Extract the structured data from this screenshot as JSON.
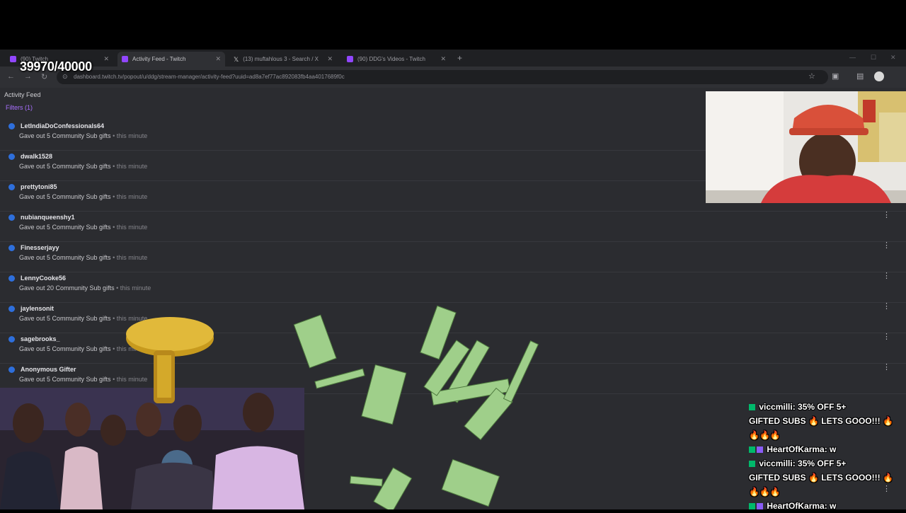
{
  "overlay": {
    "sub_goal": "39970/40000"
  },
  "browser": {
    "tabs": [
      {
        "label": "(90) Twitch",
        "active": false,
        "favicon": "twitch-icon"
      },
      {
        "label": "Activity Feed - Twitch",
        "active": true,
        "favicon": "twitch-icon"
      },
      {
        "label": "(13) muftahlous 3 - Search / X",
        "active": false,
        "favicon": "x-icon"
      },
      {
        "label": "(90) DDG's Videos - Twitch",
        "active": false,
        "favicon": "twitch-icon"
      }
    ],
    "address": "dashboard.twitch.tv/popout/u/ddg/stream-manager/activity-feed?uuid=ad8a7ef77ac892083fb4aa4017689f0c"
  },
  "activity_feed": {
    "title": "Activity Feed",
    "filters_label": "Filters (1)",
    "items": [
      {
        "user": "LetIndiaDoConfessionals64",
        "action": "Gave out 5 Community Sub gifts",
        "time": "• this minute"
      },
      {
        "user": "dwalk1528",
        "action": "Gave out 5 Community Sub gifts",
        "time": "• this minute"
      },
      {
        "user": "prettytoni85",
        "action": "Gave out 5 Community Sub gifts",
        "time": "• this minute"
      },
      {
        "user": "nubianqueenshy1",
        "action": "Gave out 5 Community Sub gifts",
        "time": "• this minute"
      },
      {
        "user": "Finesserjayy",
        "action": "Gave out 5 Community Sub gifts",
        "time": "• this minute"
      },
      {
        "user": "LennyCooke56",
        "action": "Gave out 20 Community Sub gifts",
        "time": "• this minute"
      },
      {
        "user": "jaylensonit",
        "action": "Gave out 5 Community Sub gifts",
        "time": "• this minute"
      },
      {
        "user": "sagebrooks_",
        "action": "Gave out 5 Community Sub gifts",
        "time": "• this minute"
      },
      {
        "user": "Anonymous Gifter",
        "action": "Gave out 5 Community Sub gifts",
        "time": "• this minute"
      }
    ]
  },
  "chat": {
    "messages": [
      {
        "user": "viccmilli:",
        "text": "35% OFF 5+",
        "cont": "GIFTED SUBS 🔥 LETS GOOO!!! 🔥",
        "cont2": "🔥🔥🔥"
      },
      {
        "user": "HeartOfKarma:",
        "text": "w"
      },
      {
        "user": "viccmilli:",
        "text": "35% OFF 5+",
        "cont": "GIFTED SUBS 🔥 LETS GOOO!!! 🔥",
        "cont2": "🔥🔥🔥"
      },
      {
        "user": "HeartOfKarma:",
        "text": "w"
      }
    ]
  },
  "colors": {
    "accent": "#9146ff",
    "feed_bg": "#2b2c30",
    "badge_green": "#00b96b"
  }
}
